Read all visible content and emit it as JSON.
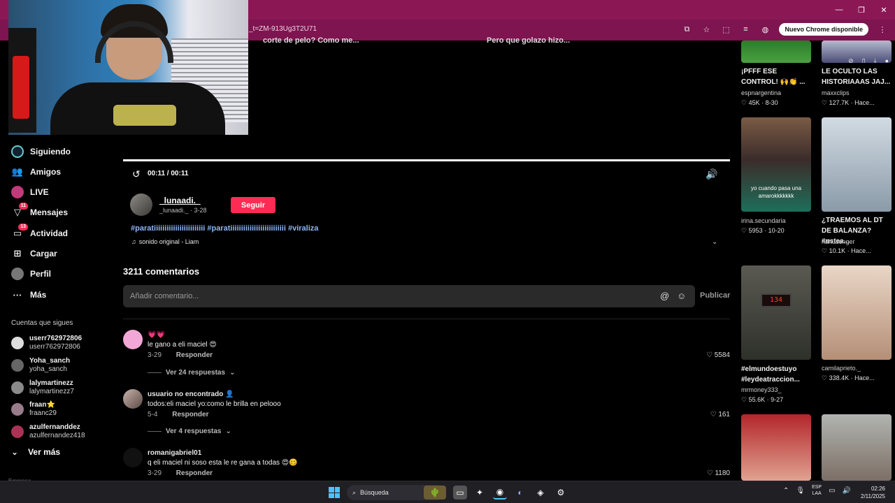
{
  "browser": {
    "url": "_t=ZM-913Ug3T2U71",
    "update_label": "Nuevo Chrome disponible"
  },
  "top_captions": {
    "left": "corte de pelo? Como me...",
    "right": "Pero que golazo hizo..."
  },
  "sidebar": {
    "items": [
      {
        "label": "Siguiendo",
        "icon": "following-icon"
      },
      {
        "label": "Amigos",
        "icon": "friends-icon"
      },
      {
        "label": "LIVE",
        "icon": "live-icon"
      },
      {
        "label": "Mensajes",
        "icon": "messages-icon",
        "badge": "11"
      },
      {
        "label": "Actividad",
        "icon": "activity-icon",
        "badge": "13"
      },
      {
        "label": "Cargar",
        "icon": "upload-icon"
      },
      {
        "label": "Perfil",
        "icon": "profile-icon"
      },
      {
        "label": "Más",
        "icon": "more-icon"
      }
    ],
    "following_heading": "Cuentas que sigues",
    "accounts": [
      {
        "name": "userr762972806",
        "handle": "userr762972806"
      },
      {
        "name": "Yoha_sanch",
        "handle": "yoha_sanch"
      },
      {
        "name": "lalymartinezz",
        "handle": "lalymartinezz7"
      },
      {
        "name": "fraan⭐",
        "handle": "fraanc29"
      },
      {
        "name": "azulfernanddez",
        "handle": "azulfernandez418"
      }
    ],
    "see_more": "Ver más",
    "footer": "Empresa"
  },
  "player": {
    "time": "00:11 / 00:11",
    "progress": 1.0
  },
  "post": {
    "author": "_lunaadi._",
    "author_sub": "_lunaadi._ · 3-28",
    "follow_label": "Seguir",
    "hashtags": "#paratiiiiiiiiiiiiiiiiiiiiiiii #paratiiiiiiiiiiiiiiiiiiiiiiiiii #viraliza",
    "sound": "sonido original - Liam"
  },
  "comments_section": {
    "count_label": "3211 comentarios",
    "placeholder": "Añadir comentario...",
    "publish_label": "Publicar",
    "comments": [
      {
        "user": "💗💗",
        "text": "le gano a eli maciel 😍",
        "date": "3-29",
        "reply": "Responder",
        "likes": "5584",
        "view_replies": "Ver 24 respuestas"
      },
      {
        "user": "usuario no encontrado 👤",
        "text": "todos:eli maciel yo:como le brilla en pelooo",
        "date": "5-4",
        "reply": "Responder",
        "likes": "161",
        "view_replies": "Ver 4 respuestas"
      },
      {
        "user": "romanigabriel01",
        "text": "q eli maciel ni soso esta le re gana a todas 😍🥴",
        "date": "3-29",
        "reply": "Responder",
        "likes": "1180"
      }
    ]
  },
  "recommendations": [
    {
      "title": "¡PFFF ESE CONTROL! 🙌👏 ...",
      "author": "espnargentina",
      "likes": "45K",
      "date": "8-30"
    },
    {
      "title": "LE OCULTO LAS HISTORIAAAS JAJ...",
      "author": "maxxclips",
      "likes": "127.7K",
      "date": "Hace..."
    },
    {
      "title": "",
      "author": "irina.secundaria",
      "likes": "5953",
      "date": "10-20",
      "overlay": "yo cuando pasa una amarokkkkkkk"
    },
    {
      "title": "¿TRAEMOS AL DT DE BALANZA? #nstea...",
      "author": "nahusenger",
      "likes": "10.1K",
      "date": "Hace..."
    },
    {
      "title": "#elmundoestuyo #leydeatraccion...",
      "author": "mrmoney333_",
      "likes": "55.6K",
      "date": "9-27",
      "overlay": "134"
    },
    {
      "title": "",
      "author": "camilaprieto._",
      "likes": "338.4K",
      "date": "Hace..."
    },
    {
      "title": "",
      "author": "",
      "likes": "",
      "date": ""
    },
    {
      "title": "",
      "author": "",
      "likes": "",
      "date": ""
    }
  ],
  "taskbar": {
    "search_label": "Búsqueda",
    "lang_top": "ESP",
    "lang_bottom": "LAA",
    "time": "02:26",
    "date": "2/11/2025"
  }
}
